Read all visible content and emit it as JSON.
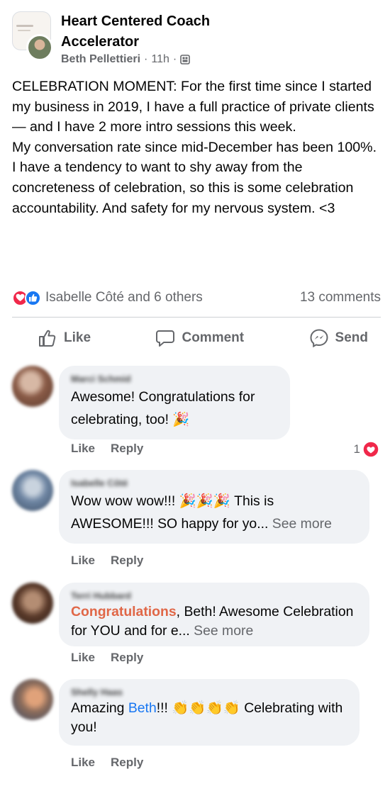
{
  "post": {
    "group_name": "Heart Centered Coach Accelerator",
    "author": "Beth Pellettieri",
    "time": "11h",
    "separator": "·",
    "paragraphs": [
      "CELEBRATION MOMENT: For the first time since I started my business in 2019, I have a full practice of private clients — and I have 2 more intro sessions this week.",
      "My conversation rate since mid-December has been 100%.",
      "I have a tendency to want to shy away from the concreteness of celebration, so this is some celebration accountability. And safety for my nervous system. <3"
    ],
    "reactions_text": "Isabelle Côté and 6 others",
    "comments_count": "13 comments"
  },
  "actions": {
    "like": "Like",
    "comment": "Comment",
    "send": "Send"
  },
  "comments": [
    {
      "name": "Marci Schmid",
      "text": "Awesome! Congratulations for celebrating, too! 🎉",
      "like": "Like",
      "reply": "Reply",
      "reaction_count": "1"
    },
    {
      "name": "Isabelle Côté",
      "text_a": "Wow wow wow!!! 🎉🎉🎉 This is AWESOME!!! SO happy for yo...",
      "see_more": "See more",
      "like": "Like",
      "reply": "Reply"
    },
    {
      "name": "Terri Hubbard",
      "highlight": "Congratulations",
      "text_a": ", Beth! Awesome Celebration for YOU and for e...",
      "see_more": "See more",
      "like": "Like",
      "reply": "Reply"
    },
    {
      "name": "Shelly Haas",
      "text_a": "Amazing ",
      "mention": "Beth",
      "text_b": "!!! 👏👏👏👏 Celebrating with you!",
      "like": "Like",
      "reply": "Reply"
    }
  ],
  "colors": {
    "secondary_text": "#65676b",
    "bubble": "#f0f2f5",
    "love": "#f0284a",
    "like": "#1877f2",
    "highlight": "#e06747"
  },
  "icons": [
    "privacy-icon",
    "love-reaction-icon",
    "like-reaction-icon",
    "thumbs-up-icon",
    "comment-icon",
    "messenger-icon",
    "heart-icon"
  ]
}
